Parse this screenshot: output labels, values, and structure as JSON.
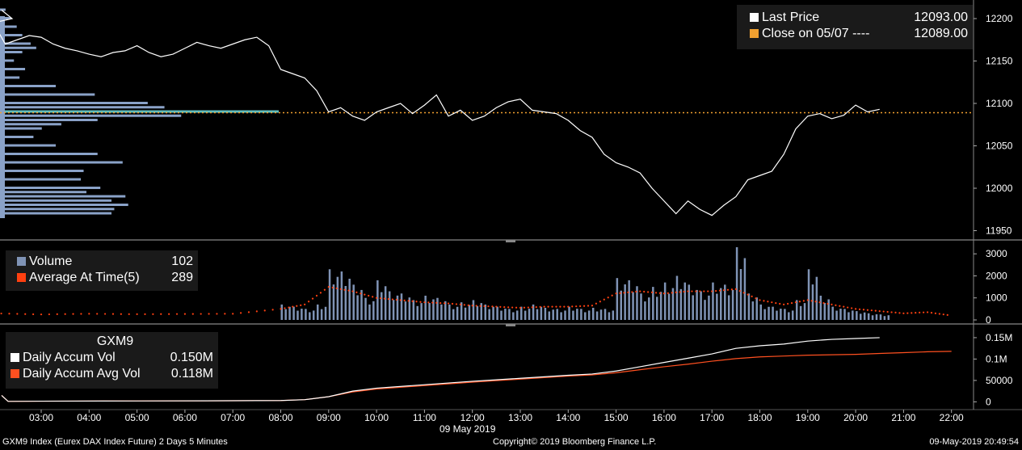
{
  "colors": {
    "background": "#000000",
    "price_line": "#ffffff",
    "close_line": "#f0a030",
    "volume_bars": "#7f93b5",
    "avg_volume": "#ff4010",
    "accum_vol": "#ffffff",
    "accum_avg": "#ff5020",
    "profile_bars": "#8aa2c8",
    "profile_highlight": "#5fbfbf",
    "legend_bg": "#1a1a1a"
  },
  "price_legend": {
    "last_price_label": "Last Price",
    "last_price_value": "12093.00",
    "close_label": "Close on 05/07 ----",
    "close_value": "12089.00"
  },
  "volume_legend": {
    "volume_label": "Volume",
    "volume_value": "102",
    "avg_label": "Average At Time(5)",
    "avg_value": "289"
  },
  "accum_legend": {
    "title": "GXM9",
    "accum_label": "Daily Accum Vol",
    "accum_value": "0.150M",
    "avg_label": "Daily Accum Avg Vol",
    "avg_value": "0.118M"
  },
  "footer": {
    "left": "GXM9 Index (Eurex DAX Index Future) 2 Days 5 Minutes",
    "center": "Copyright© 2019 Bloomberg Finance L.P.",
    "right": "09-May-2019 20:49:54"
  },
  "x_axis": {
    "date_label": "09 May 2019",
    "ticks": [
      "03:00",
      "04:00",
      "05:00",
      "06:00",
      "07:00",
      "08:00",
      "09:00",
      "10:00",
      "11:00",
      "12:00",
      "13:00",
      "14:00",
      "15:00",
      "16:00",
      "17:00",
      "18:00",
      "19:00",
      "20:00",
      "21:00",
      "22:00"
    ]
  },
  "chart_data": [
    {
      "type": "line",
      "panel": "price",
      "ylim": [
        11940,
        12220
      ],
      "yticks": [
        "12200",
        "12150",
        "12100",
        "12050",
        "12000",
        "11950"
      ],
      "close_value": 12089,
      "series": [
        {
          "name": "Last Price",
          "x": [
            2.0,
            2.25,
            2.5,
            2.75,
            3.0,
            3.25,
            3.5,
            3.75,
            4.0,
            4.25,
            4.5,
            4.75,
            5.0,
            5.25,
            5.5,
            5.75,
            6.0,
            6.25,
            6.5,
            6.75,
            7.0,
            7.25,
            7.5,
            7.75,
            8.0,
            8.25,
            8.5,
            8.75,
            9.0,
            9.25,
            9.5,
            9.75,
            10.0,
            10.25,
            10.5,
            10.75,
            11.0,
            11.25,
            11.5,
            11.75,
            12.0,
            12.25,
            12.5,
            12.75,
            13.0,
            13.25,
            13.5,
            13.75,
            14.0,
            14.25,
            14.5,
            14.75,
            15.0,
            15.25,
            15.5,
            15.75,
            16.0,
            16.25,
            16.5,
            16.75,
            17.0,
            17.25,
            17.5,
            17.75,
            18.0,
            18.25,
            18.5,
            18.75,
            19.0,
            19.25,
            19.5,
            19.75,
            20.0,
            20.25,
            20.5
          ],
          "y": [
            12195,
            12170,
            12175,
            12180,
            12178,
            12170,
            12165,
            12162,
            12158,
            12155,
            12160,
            12162,
            12168,
            12160,
            12155,
            12158,
            12165,
            12172,
            12168,
            12165,
            12170,
            12175,
            12178,
            12168,
            12140,
            12135,
            12130,
            12115,
            12090,
            12095,
            12085,
            12080,
            12090,
            12095,
            12100,
            12088,
            12098,
            12110,
            12085,
            12092,
            12080,
            12085,
            12095,
            12102,
            12105,
            12092,
            12090,
            12088,
            12080,
            12068,
            12060,
            12040,
            12030,
            12025,
            12018,
            12000,
            11985,
            11970,
            11985,
            11975,
            11968,
            11980,
            11990,
            12010,
            12015,
            12020,
            12040,
            12070,
            12085,
            12088,
            12082,
            12086,
            12098,
            12090,
            12093
          ]
        }
      ]
    },
    {
      "type": "bar",
      "panel": "volume",
      "ylim": [
        0,
        3300
      ],
      "yticks": [
        "3000",
        "2000",
        "1000",
        "0"
      ],
      "series": [
        {
          "name": "Volume",
          "x": [
            8.0,
            8.25,
            8.5,
            8.75,
            9.0,
            9.25,
            9.5,
            9.75,
            10.0,
            10.25,
            10.5,
            10.75,
            11.0,
            11.25,
            11.5,
            11.75,
            12.0,
            12.25,
            12.5,
            12.75,
            13.0,
            13.25,
            13.5,
            13.75,
            14.0,
            14.25,
            14.5,
            14.75,
            15.0,
            15.25,
            15.5,
            15.75,
            16.0,
            16.25,
            16.5,
            16.75,
            17.0,
            17.25,
            17.5,
            17.75,
            18.0,
            18.25,
            18.5,
            18.75,
            19.0,
            19.25,
            19.5,
            19.75,
            20.0,
            20.25,
            20.5
          ],
          "y": [
            700,
            600,
            500,
            700,
            2300,
            2200,
            1600,
            1000,
            1800,
            1300,
            1200,
            900,
            1100,
            1000,
            700,
            800,
            900,
            700,
            600,
            500,
            600,
            700,
            550,
            500,
            600,
            500,
            550,
            500,
            1900,
            1800,
            1200,
            1500,
            1700,
            2000,
            1600,
            1300,
            1700,
            1600,
            3300,
            1200,
            700,
            600,
            500,
            900,
            2300,
            1100,
            600,
            500,
            400,
            300,
            250
          ]
        },
        {
          "name": "Average At Time(5)",
          "x": [
            2.0,
            3.0,
            4.0,
            5.0,
            6.0,
            7.0,
            8.0,
            8.5,
            9.0,
            9.5,
            10.0,
            10.5,
            11.0,
            11.5,
            12.0,
            12.5,
            13.0,
            13.5,
            14.0,
            14.5,
            15.0,
            15.5,
            16.0,
            16.5,
            17.0,
            17.5,
            18.0,
            18.5,
            19.0,
            19.5,
            20.0,
            20.5,
            21.0,
            21.5,
            22.0
          ],
          "y": [
            300,
            250,
            280,
            260,
            270,
            280,
            500,
            700,
            1500,
            1300,
            1000,
            900,
            800,
            750,
            650,
            600,
            550,
            600,
            600,
            650,
            1200,
            1300,
            1200,
            1300,
            1300,
            1400,
            900,
            700,
            900,
            700,
            500,
            400,
            300,
            350,
            200
          ]
        }
      ]
    },
    {
      "type": "line",
      "panel": "accumulation",
      "ylim": [
        -5000,
        165000
      ],
      "yticks": [
        "0.15M",
        "0.1M",
        "50000",
        "0"
      ],
      "series": [
        {
          "name": "Daily Accum Vol",
          "x": [
            2.0,
            2.05,
            3.0,
            5.0,
            7.0,
            8.0,
            8.5,
            9.0,
            9.5,
            10.0,
            11.0,
            12.0,
            13.0,
            14.0,
            14.5,
            15.0,
            15.5,
            16.0,
            16.5,
            17.0,
            17.5,
            18.0,
            18.5,
            19.0,
            19.5,
            20.0,
            20.5
          ],
          "y": [
            15000,
            1000,
            1500,
            2000,
            2500,
            3000,
            5000,
            12000,
            25000,
            32000,
            40000,
            48000,
            55000,
            62000,
            65000,
            72000,
            82000,
            92000,
            102000,
            112000,
            125000,
            131000,
            135000,
            142000,
            146000,
            148000,
            150000
          ]
        },
        {
          "name": "Daily Accum Avg Vol",
          "x": [
            2.0,
            2.05,
            3.0,
            5.0,
            7.0,
            8.0,
            8.5,
            9.0,
            9.5,
            10.0,
            11.0,
            12.0,
            13.0,
            14.0,
            14.5,
            15.0,
            15.5,
            16.0,
            16.5,
            17.0,
            17.5,
            18.0,
            18.5,
            19.0,
            19.5,
            20.0,
            20.5,
            21.0,
            21.5,
            22.0
          ],
          "y": [
            15000,
            1000,
            1500,
            2000,
            2500,
            3000,
            5000,
            12000,
            23000,
            30000,
            38000,
            46000,
            53000,
            60000,
            63000,
            68000,
            75000,
            82000,
            88000,
            95000,
            101000,
            105000,
            107000,
            109000,
            110000,
            111000,
            113000,
            115000,
            117000,
            118000
          ]
        }
      ]
    },
    {
      "type": "bar",
      "panel": "volume-profile",
      "orientation": "horizontal",
      "x_units": "relative length (0-1)",
      "y": [
        12210,
        12200,
        12190,
        12180,
        12170,
        12165,
        12160,
        12150,
        12140,
        12130,
        12120,
        12110,
        12100,
        12095,
        12090,
        12085,
        12080,
        12075,
        12070,
        12060,
        12050,
        12040,
        12030,
        12020,
        12010,
        12000,
        11995,
        11990,
        11985,
        11980,
        11975,
        11970
      ],
      "x": [
        0.02,
        0.04,
        0.06,
        0.08,
        0.11,
        0.13,
        0.08,
        0.05,
        0.09,
        0.07,
        0.2,
        0.34,
        0.53,
        0.59,
        1.0,
        0.65,
        0.35,
        0.22,
        0.15,
        0.12,
        0.2,
        0.35,
        0.44,
        0.3,
        0.29,
        0.36,
        0.31,
        0.45,
        0.4,
        0.46,
        0.41,
        0.4
      ]
    }
  ]
}
